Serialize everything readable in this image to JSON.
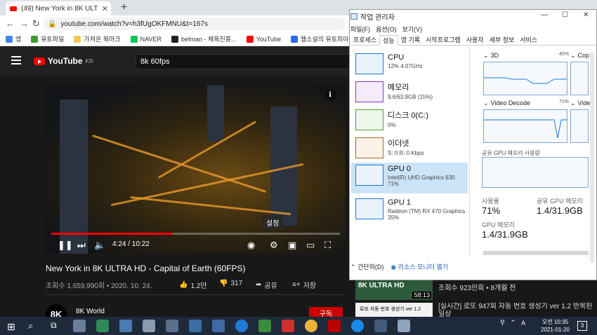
{
  "browser": {
    "tab_title": "(49) New York in 8K ULTRA",
    "url": "youtube.com/watch?v=h3fUgOKFMNU&t=167s",
    "bookmarks": [
      "앱",
      "유토파일",
      "가져온 북마크",
      "NAVER",
      "betman - 체육진흥...",
      "YouTube",
      "웹소설의 유토피아..."
    ]
  },
  "youtube": {
    "logo_text": "YouTube",
    "region": "KR",
    "search_value": "8k 60fps",
    "video": {
      "title": "New York in 8K ULTRA HD - Capital of Earth (60FPS)",
      "views_date": "조회수 1,659,990회 • 2020. 10. 24.",
      "time": "4:24 / 10:22",
      "progress_fraction": 0.42,
      "settings_tooltip": "설정",
      "likes": "1.2만",
      "dislikes": "317",
      "share": "공유",
      "save": "저장"
    },
    "channel": {
      "name": "8K World",
      "avatar_text": "8K",
      "subscribe": "구독"
    },
    "sidebar": [
      {
        "badge": "8K ULTRA HD",
        "duration": "58:13",
        "meta": "조회수 923만회 • 8개월 전"
      },
      {
        "thumb_text": "로또 자동 번호 생성기 ver 1.2",
        "title": "[실시간] 로또 947회 자동 번호 생성기 ver 1.2 반복된 일상"
      }
    ]
  },
  "task_manager": {
    "title": "작업 관리자",
    "menu": [
      "파일(F)",
      "옵션(O)",
      "보기(V)"
    ],
    "tabs": [
      "프로세스",
      "성능",
      "앱 기록",
      "시작프로그램",
      "사용자",
      "세부 정보",
      "서비스"
    ],
    "active_tab": "성능",
    "resources": [
      {
        "name": "CPU",
        "sub": "12% 4.07GHz",
        "color": "#1a7ad6"
      },
      {
        "name": "메모리",
        "sub": "9.6/63.9GB (15%)",
        "color": "#8b2fc9"
      },
      {
        "name": "디스크 0(C:)",
        "sub": "0%",
        "color": "#4da02c"
      },
      {
        "name": "이더넷",
        "sub": "S: 0 R: 0 Kbps",
        "color": "#a76a1a"
      },
      {
        "name": "GPU 0",
        "sub": "Intel(R) UHD Graphics 630",
        "sub2": "71%",
        "color": "#1a7ad6",
        "selected": true
      },
      {
        "name": "GPU 1",
        "sub": "Radeon (TM) RX 470 Graphics",
        "sub2": "35%",
        "color": "#1a7ad6"
      }
    ],
    "graphs": {
      "g1_label": "3D",
      "g1_pct": "45%",
      "g2_label": "Cop",
      "g3_label": "Video Decode",
      "g3_pct": "71%",
      "g4_label": "Vide",
      "shared_label": "공유 GPU 메모리 사용량"
    },
    "stats": {
      "usage_label": "사용률",
      "usage_value": "71%",
      "shared_label": "공유 GPU 메모리",
      "shared_value": "1.4/31.9GB",
      "gpu_mem_label": "GPU 메모리",
      "gpu_mem_value": "1.4/31.9GB"
    },
    "footer": {
      "brief": "간단히(D)",
      "monitor": "리소스 모니터 열기"
    }
  },
  "taskbar": {
    "lang": "A",
    "time": "오전 10:35",
    "date": "2021-01-20",
    "notif_count": "3"
  }
}
